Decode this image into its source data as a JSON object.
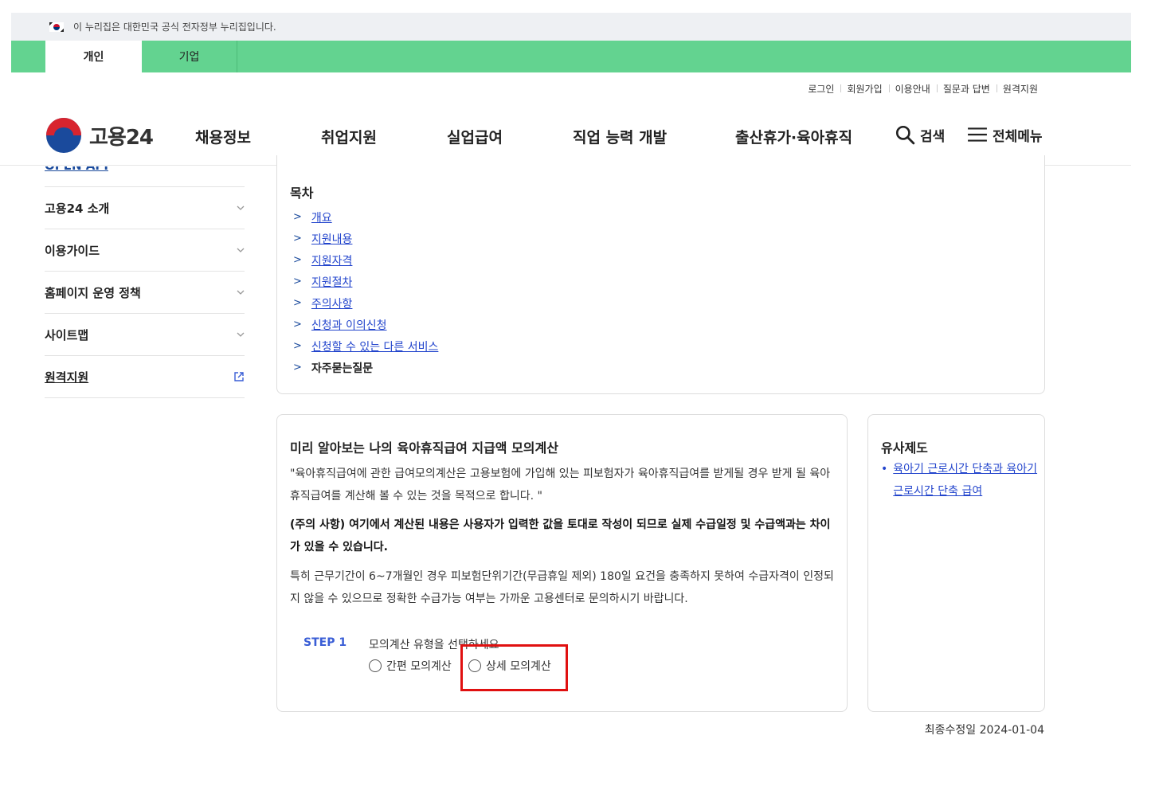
{
  "gov_banner": {
    "text": "이 누리집은 대한민국 공식 전자정부 누리집입니다."
  },
  "user_tabs": [
    {
      "label": "개인",
      "active": true
    },
    {
      "label": "기업",
      "active": false
    }
  ],
  "util_links": [
    "로그인",
    "회원가입",
    "이용안내",
    "질문과 답변",
    "원격지원"
  ],
  "logo": {
    "text": "고용24"
  },
  "gnb": {
    "menus": [
      "채용정보",
      "취업지원",
      "실업급여",
      "직업 능력 개발",
      "출산휴가·육아휴직"
    ],
    "search_label": "검색",
    "all_menu_label": "전체메뉴"
  },
  "lnb": {
    "cut_item": "OPEN API",
    "items": [
      {
        "label": "고용24 소개"
      },
      {
        "label": "이용가이드"
      },
      {
        "label": "홈페이지 운영 정책"
      },
      {
        "label": "사이트맵"
      },
      {
        "label": "원격지원"
      }
    ]
  },
  "toc": {
    "title": "목차",
    "items": [
      "개요",
      "지원내용",
      "지원자격",
      "지원절차",
      "주의사항",
      "신청과 이의신청",
      "신청할 수 있는 다른 서비스",
      "자주묻는질문"
    ]
  },
  "calc": {
    "title": "미리 알아보는 나의 육아휴직급여 지급액 모의계산",
    "intro": "\"육아휴직급여에 관한 급여모의계산은 고용보험에 가입해 있는 피보험자가 육아휴직급여를 받게될 경우 받게 될 육아휴직급여를 계산해 볼 수 있는 것을 목적으로 합니다. \"",
    "caution": "(주의 사항) 여기에서 계산된 내용은 사용자가 입력한 값을 토대로 작성이 되므로 실제 수급일정 및 수급액과는 차이가 있을 수 있습니다.",
    "note": "특히 근무기간이 6~7개월인 경우 피보험단위기간(무급휴일 제외) 180일 요건을 충족하지 못하여 수급자격이 인정되지 않을 수 있으므로 정확한 수급가능 여부는 가까운 고용센터로 문의하시기 바랍니다.",
    "step_label": "STEP 1",
    "step_question": "모의계산 유형을 선택하세요",
    "options": [
      "간편 모의계산",
      "상세 모의계산"
    ]
  },
  "similar": {
    "title": "유사제도",
    "link": "육아기 근로시간 단축과 육아기 근로시간 단축 급여"
  },
  "updated": "최종수정일 2024-01-04"
}
